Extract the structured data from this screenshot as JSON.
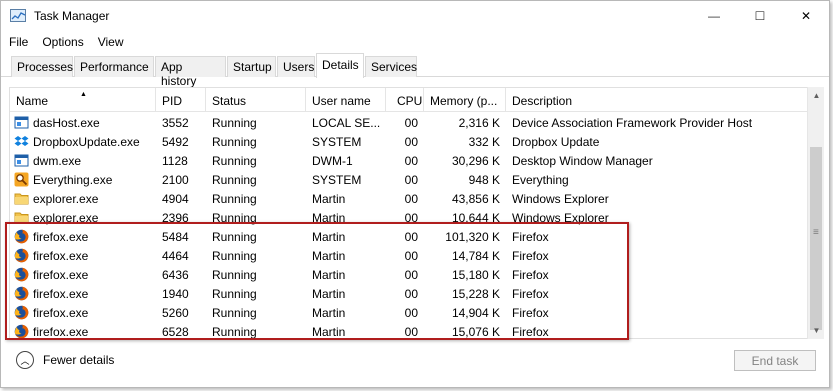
{
  "window": {
    "title": "Task Manager"
  },
  "title_buttons": {
    "minimize": "—",
    "maximize": "☐",
    "close": "✕"
  },
  "menu": [
    "File",
    "Options",
    "View"
  ],
  "tabs": [
    "Processes",
    "Performance",
    "App history",
    "Startup",
    "Users",
    "Details",
    "Services"
  ],
  "active_tab": "Details",
  "columns": [
    "Name",
    "PID",
    "Status",
    "User name",
    "CPU",
    "Memory (p...",
    "Description"
  ],
  "sorted_column": "Name",
  "rows": [
    {
      "icon": "window-app-icon",
      "name": "dasHost.exe",
      "pid": "3552",
      "status": "Running",
      "user": "LOCAL SE...",
      "cpu": "00",
      "memory": "2,316 K",
      "description": "Device Association Framework Provider Host"
    },
    {
      "icon": "dropbox-icon",
      "name": "DropboxUpdate.exe",
      "pid": "5492",
      "status": "Running",
      "user": "SYSTEM",
      "cpu": "00",
      "memory": "332 K",
      "description": "Dropbox Update"
    },
    {
      "icon": "window-app-icon",
      "name": "dwm.exe",
      "pid": "1128",
      "status": "Running",
      "user": "DWM-1",
      "cpu": "00",
      "memory": "30,296 K",
      "description": "Desktop Window Manager"
    },
    {
      "icon": "magnifier-icon",
      "name": "Everything.exe",
      "pid": "2100",
      "status": "Running",
      "user": "SYSTEM",
      "cpu": "00",
      "memory": "948 K",
      "description": "Everything"
    },
    {
      "icon": "folder-icon",
      "name": "explorer.exe",
      "pid": "4904",
      "status": "Running",
      "user": "Martin",
      "cpu": "00",
      "memory": "43,856 K",
      "description": "Windows Explorer"
    },
    {
      "icon": "folder-icon",
      "name": "explorer.exe",
      "pid": "2396",
      "status": "Running",
      "user": "Martin",
      "cpu": "00",
      "memory": "10,644 K",
      "description": "Windows Explorer"
    },
    {
      "icon": "firefox-icon",
      "name": "firefox.exe",
      "pid": "5484",
      "status": "Running",
      "user": "Martin",
      "cpu": "00",
      "memory": "101,320 K",
      "description": "Firefox"
    },
    {
      "icon": "firefox-icon",
      "name": "firefox.exe",
      "pid": "4464",
      "status": "Running",
      "user": "Martin",
      "cpu": "00",
      "memory": "14,784 K",
      "description": "Firefox"
    },
    {
      "icon": "firefox-icon",
      "name": "firefox.exe",
      "pid": "6436",
      "status": "Running",
      "user": "Martin",
      "cpu": "00",
      "memory": "15,180 K",
      "description": "Firefox"
    },
    {
      "icon": "firefox-icon",
      "name": "firefox.exe",
      "pid": "1940",
      "status": "Running",
      "user": "Martin",
      "cpu": "00",
      "memory": "15,228 K",
      "description": "Firefox"
    },
    {
      "icon": "firefox-icon",
      "name": "firefox.exe",
      "pid": "5260",
      "status": "Running",
      "user": "Martin",
      "cpu": "00",
      "memory": "14,904 K",
      "description": "Firefox"
    },
    {
      "icon": "firefox-icon",
      "name": "firefox.exe",
      "pid": "6528",
      "status": "Running",
      "user": "Martin",
      "cpu": "00",
      "memory": "15,076 K",
      "description": "Firefox"
    }
  ],
  "footer": {
    "fewer_details": "Fewer details",
    "end_task": "End task"
  },
  "colors": {
    "highlight_border": "#b01d1d",
    "accent": "#0066cc"
  }
}
